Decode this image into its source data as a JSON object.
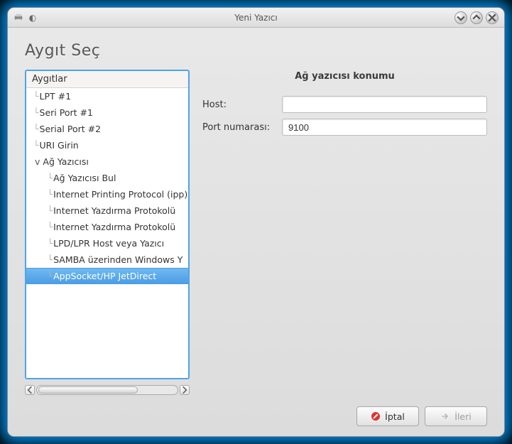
{
  "window": {
    "title": "Yeni Yazıcı"
  },
  "heading": "Aygıt Seç",
  "tree": {
    "header": "Aygıtlar",
    "items": [
      {
        "label": "LPT #1",
        "depth": 1
      },
      {
        "label": "Seri Port #1",
        "depth": 1
      },
      {
        "label": "Serial Port #2",
        "depth": 1
      },
      {
        "label": "URI Girin",
        "depth": 1
      },
      {
        "label": "Ağ Yazıcısı",
        "depth": 1,
        "expander": "v"
      },
      {
        "label": "Ağ Yazıcısı Bul",
        "depth": 2
      },
      {
        "label": "Internet Printing Protocol (ipp)",
        "depth": 2
      },
      {
        "label": "Internet Yazdırma Protokolü",
        "depth": 2
      },
      {
        "label": "Internet Yazdırma Protokolü",
        "depth": 2
      },
      {
        "label": "LPD/LPR Host veya Yazıcı",
        "depth": 2
      },
      {
        "label": "SAMBA üzerinden Windows Y",
        "depth": 2
      },
      {
        "label": "AppSocket/HP JetDirect",
        "depth": 2,
        "selected": true
      }
    ]
  },
  "panel": {
    "title": "Ağ yazıcısı konumu",
    "host_label": "Host:",
    "host_value": "",
    "port_label": "Port numarası:",
    "port_value": "9100"
  },
  "buttons": {
    "cancel": "İptal",
    "forward": "İleri"
  }
}
